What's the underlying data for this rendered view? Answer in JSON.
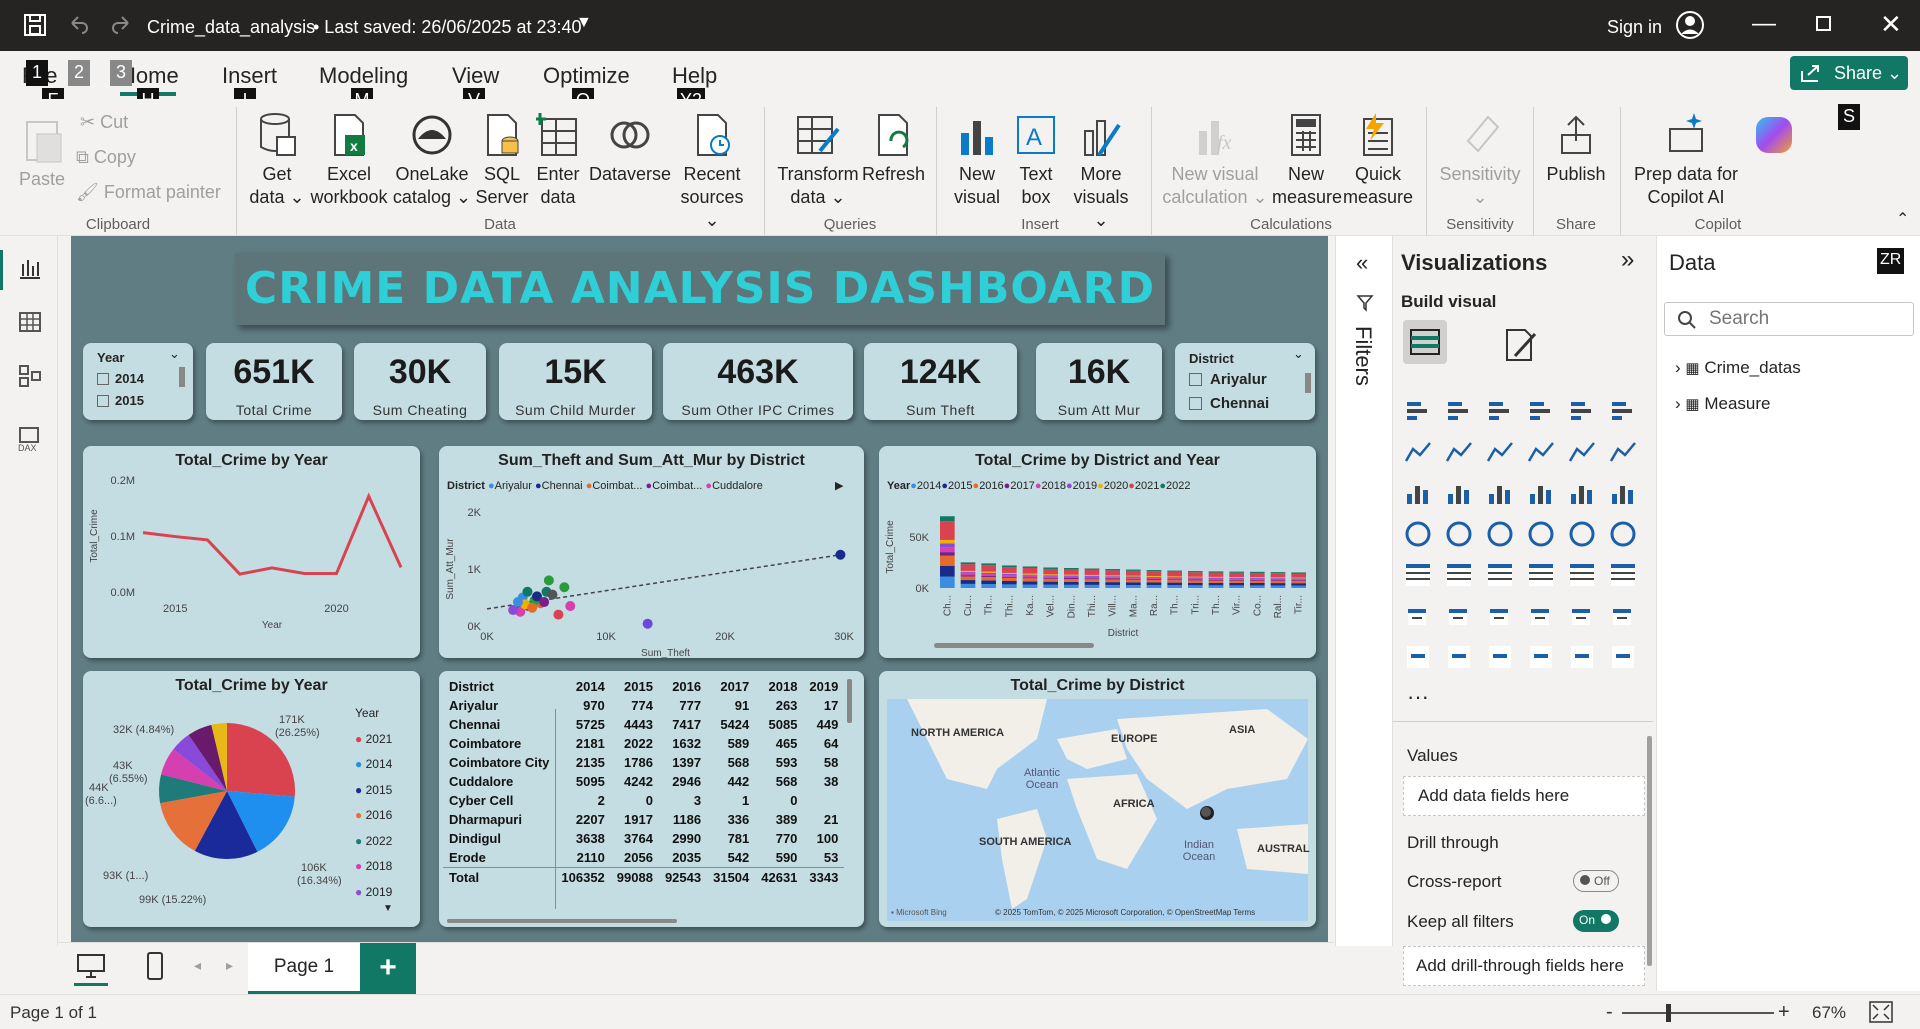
{
  "titlebar": {
    "file": "Crime_data_analysis",
    "saved": "• Last saved: 26/06/2025 at 23:40",
    "signin": "Sign in"
  },
  "tabs": [
    {
      "label": "File",
      "key": "F"
    },
    {
      "label": "Home",
      "key": "H"
    },
    {
      "label": "Insert",
      "key": "I"
    },
    {
      "label": "Modeling",
      "key": "M"
    },
    {
      "label": "View",
      "key": "V"
    },
    {
      "label": "Optimize",
      "key": "O"
    },
    {
      "label": "Help",
      "key": "Y2"
    }
  ],
  "keytips_top": [
    "1",
    "2",
    "3"
  ],
  "share": "Share",
  "ribbon": {
    "clipboard": {
      "paste": "Paste",
      "cut": "Cut",
      "copy": "Copy",
      "format": "Format painter",
      "group": "Clipboard"
    },
    "data": {
      "getdata": "Get data",
      "excel": "Excel workbook",
      "onelake": "OneLake catalog",
      "sql": "SQL Server",
      "enter": "Enter data",
      "dataverse": "Dataverse",
      "recent": "Recent sources",
      "group": "Data"
    },
    "queries": {
      "transform": "Transform data",
      "refresh": "Refresh",
      "group": "Queries"
    },
    "insert": {
      "newvisual": "New visual",
      "textbox": "Text box",
      "morevisuals": "More visuals",
      "group": "Insert"
    },
    "calcs": {
      "newvcalc": "New visual calculation",
      "newmeasure": "New measure",
      "quick": "Quick measure",
      "group": "Calculations"
    },
    "sensitivity": {
      "label": "Sensitivity",
      "group": "Sensitivity"
    },
    "share": {
      "publish": "Publish",
      "group": "Share"
    },
    "copilot": {
      "prep": "Prep data for Copilot AI",
      "copilot": "Copilot",
      "group": "Copilot",
      "key": "S"
    }
  },
  "dashboard": {
    "title": "CRIME DATA ANALYSIS DASHBOARD",
    "year_slicer": {
      "header": "Year",
      "items": [
        "2014",
        "2015"
      ]
    },
    "district_slicer": {
      "header": "District",
      "items": [
        "Ariyalur",
        "Chennai"
      ]
    },
    "kpis": [
      {
        "value": "651K",
        "label": "Total Crime"
      },
      {
        "value": "30K",
        "label": "Sum Cheating"
      },
      {
        "value": "15K",
        "label": "Sum Child Murder"
      },
      {
        "value": "463K",
        "label": "Sum Other IPC Crimes"
      },
      {
        "value": "124K",
        "label": "Sum Theft"
      },
      {
        "value": "16K",
        "label": "Sum Att Mur"
      }
    ],
    "line_title": "Total_Crime by Year",
    "scatter_title": "Sum_Theft and Sum_Att_Mur by District",
    "scatter_legend": [
      "District",
      "Ariyalur",
      "Chennai",
      "Coimbat...",
      "Coimbat...",
      "Cuddalore"
    ],
    "bar_title": "Total_Crime by District and Year",
    "bar_legend_title": "Year",
    "pie_title": "Total_Crime by Year",
    "pie_legend_title": "Year",
    "pie_labels": [
      "171K (26.25%)",
      "106K (16.34%)",
      "99K (15.22%)",
      "93K (1...)",
      "44K (6.6...)",
      "43K (6.55%)",
      "32K (4.84%)"
    ],
    "map_title": "Total_Crime by District",
    "map_labels": [
      "NORTH AMERICA",
      "EUROPE",
      "ASIA",
      "Atlantic Ocean",
      "AFRICA",
      "SOUTH AMERICA",
      "Indian Ocean",
      "AUSTRAL"
    ],
    "map_credit": "© 2025 TomTom, © 2025 Microsoft Corporation, © OpenStreetMap  Terms",
    "map_bing": "Microsoft Bing",
    "table": {
      "headers": [
        "District",
        "2014",
        "2015",
        "2016",
        "2017",
        "2018",
        "2019"
      ],
      "rows": [
        [
          "Ariyalur",
          "970",
          "774",
          "777",
          "91",
          "263",
          "17"
        ],
        [
          "Chennai",
          "5725",
          "4443",
          "7417",
          "5424",
          "5085",
          "449"
        ],
        [
          "Coimbatore",
          "2181",
          "2022",
          "1632",
          "589",
          "465",
          "64"
        ],
        [
          "Coimbatore City",
          "2135",
          "1786",
          "1397",
          "568",
          "593",
          "58"
        ],
        [
          "Cuddalore",
          "5095",
          "4242",
          "2946",
          "442",
          "568",
          "38"
        ],
        [
          "Cyber Cell",
          "2",
          "0",
          "3",
          "1",
          "0",
          ""
        ],
        [
          "Dharmapuri",
          "2207",
          "1917",
          "1186",
          "336",
          "389",
          "21"
        ],
        [
          "Dindigul",
          "3638",
          "3764",
          "2990",
          "781",
          "770",
          "100"
        ],
        [
          "Erode",
          "2110",
          "2056",
          "2035",
          "542",
          "590",
          "53"
        ]
      ],
      "total": [
        "Total",
        "106352",
        "99088",
        "92543",
        "31504",
        "42631",
        "3343"
      ]
    }
  },
  "chart_data": [
    {
      "type": "line",
      "title": "Total_Crime by Year",
      "xlabel": "Year",
      "ylabel": "Total_Crime",
      "x": [
        2014,
        2015,
        2016,
        2017,
        2018,
        2019,
        2020,
        2021,
        2022
      ],
      "values": [
        106000,
        99000,
        93000,
        32000,
        43000,
        33000,
        33000,
        171000,
        44000
      ],
      "ylim": [
        0,
        200000
      ],
      "yticks": [
        "0.0M",
        "0.1M",
        "0.2M"
      ],
      "xticks": [
        "2015",
        "2020"
      ]
    },
    {
      "type": "scatter",
      "title": "Sum_Theft and Sum_Att_Mur by District",
      "xlabel": "Sum_Theft",
      "ylabel": "Sum_Att_Mur",
      "xticks": [
        "0K",
        "10K",
        "20K",
        "30K"
      ],
      "yticks": [
        "0K",
        "1K",
        "2K"
      ],
      "xlim": [
        0,
        30000
      ],
      "ylim": [
        0,
        2000
      ],
      "points": [
        [
          3000,
          500
        ],
        [
          2500,
          300
        ],
        [
          4500,
          400
        ],
        [
          3500,
          350
        ],
        [
          2800,
          250
        ],
        [
          5000,
          600
        ],
        [
          6000,
          200
        ],
        [
          4000,
          450
        ],
        [
          3200,
          380
        ],
        [
          5500,
          550
        ],
        [
          2200,
          280
        ],
        [
          3800,
          320
        ],
        [
          4200,
          520
        ],
        [
          2600,
          420
        ],
        [
          3400,
          600
        ],
        [
          6500,
          680
        ],
        [
          5200,
          800
        ],
        [
          4800,
          420
        ],
        [
          7000,
          350
        ],
        [
          13500,
          40
        ],
        [
          29700,
          1250
        ]
      ]
    },
    {
      "type": "bar",
      "title": "Total_Crime by District and Year",
      "xlabel": "District",
      "ylabel": "Total_Crime",
      "yticks": [
        "0K",
        "50K"
      ],
      "legend": [
        "2014",
        "2015",
        "2016",
        "2017",
        "2018",
        "2019",
        "2020",
        "2021",
        "2022"
      ],
      "categories": [
        "Ch...",
        "Cu...",
        "Th...",
        "Thi...",
        "Ka...",
        "Vel...",
        "Din...",
        "Thi...",
        "Vill...",
        "Ma...",
        "Ra...",
        "Th...",
        "Tri...",
        "Th...",
        "Vir...",
        "Co...",
        "Ral...",
        "Tir..."
      ],
      "values": [
        70000,
        25000,
        24000,
        22000,
        21000,
        20000,
        19500,
        19000,
        18500,
        18000,
        17500,
        17000,
        16500,
        16200,
        16000,
        15800,
        15500,
        15200
      ]
    },
    {
      "type": "pie",
      "title": "Total_Crime by Year",
      "legend": [
        "2021",
        "2014",
        "2015",
        "2016",
        "2022",
        "2018",
        "2019"
      ],
      "values": [
        171,
        106,
        99,
        93,
        44,
        43,
        32
      ]
    }
  ],
  "colors": {
    "accent": "#117865",
    "canvas": "#5f7d83",
    "card": "#c4dde3",
    "title": "#2ecfd6"
  },
  "filters_label": "Filters",
  "viz": {
    "title": "Visualizations",
    "build": "Build visual",
    "values": "Values",
    "add_fields": "Add data fields here",
    "drill": "Drill through",
    "cross": "Cross-report",
    "cross_state": "Off",
    "keep": "Keep all filters",
    "keep_state": "On",
    "add_drill": "Add drill-through fields here"
  },
  "data_pane": {
    "title": "Data",
    "key": "ZR",
    "search_placeholder": "Search",
    "tables": [
      "Crime_datas",
      "Measure"
    ]
  },
  "page": {
    "tab": "Page 1",
    "add": "+"
  },
  "status": {
    "page": "Page 1 of 1",
    "zoom": "67%",
    "minus": "-",
    "plus": "+"
  }
}
